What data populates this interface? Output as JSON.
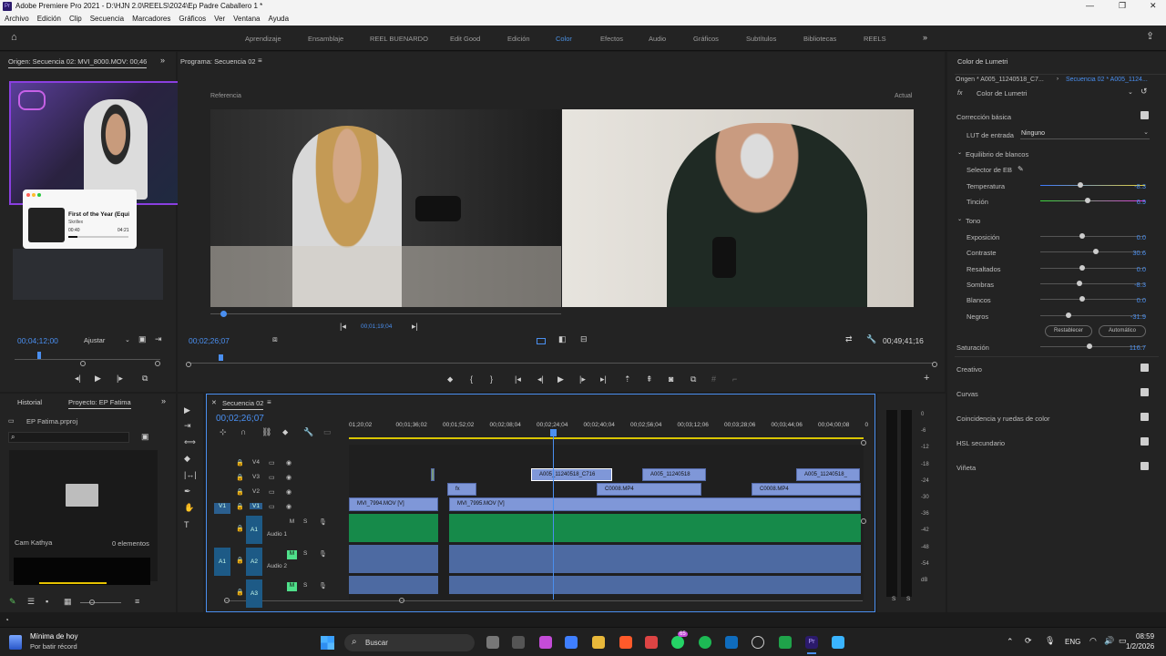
{
  "titlebar": {
    "title": "Adobe Premiere Pro 2021 - D:\\HJN 2.0\\REELS\\2024\\Ep Padre Caballero 1 *",
    "logo": "Pr"
  },
  "menu": [
    "Archivo",
    "Edición",
    "Clip",
    "Secuencia",
    "Marcadores",
    "Gráficos",
    "Ver",
    "Ventana",
    "Ayuda"
  ],
  "workspaces": [
    "Aprendizaje",
    "Ensamblaje",
    "REEL BUENARDO",
    "Edit Good",
    "Edición",
    "Color",
    "Efectos",
    "Audio",
    "Gráficos",
    "Subtítulos",
    "Bibliotecas",
    "REELS"
  ],
  "active_workspace": "Color",
  "source": {
    "tab": "Origen: Secuencia 02: MVI_8000.MOV: 00;46;0",
    "timecode": "00;04;12;00",
    "fit": "Ajustar"
  },
  "music_widget": {
    "title": "First of the Year (Equi",
    "artist": "Skrillex",
    "time_start": "00:40",
    "time_end": "04:21"
  },
  "program": {
    "tab": "Programa: Secuencia 02",
    "ref_label": "Referencia",
    "current_label": "Actual",
    "ref_timecode": "00;01;19;04",
    "timecode": "00;02;26;07",
    "duration": "00;49;41;16"
  },
  "project": {
    "tab_history": "Historial",
    "tab_project": "Proyecto: EP Fatima",
    "file": "EP Fatima.prproj",
    "bin_name": "Cam Kathya",
    "count": "0 elementos"
  },
  "timeline": {
    "tab": "Secuencia 02",
    "timecode": "00;02;26;07",
    "ruler": [
      "01;20;02",
      "00;01;36;02",
      "00;01;52;02",
      "00;02;08;04",
      "00;02;24;04",
      "00;02;40;04",
      "00;02;56;04",
      "00;03;12;06",
      "00;03;28;06",
      "00;03;44;06",
      "00;04;00;08",
      "0"
    ],
    "tracks_video": [
      "V4",
      "V3",
      "V2",
      "V1"
    ],
    "tracks_audio": [
      "A1",
      "A2",
      "A3"
    ],
    "audio_names": [
      "Audio 1",
      "Audio 2"
    ],
    "src_v": "V1",
    "src_a": "A1",
    "mute": "M",
    "solo": "S",
    "clips": {
      "v3a": "A005_11240518_C716",
      "v3b": "A005_11240518",
      "v3c": "A005_11240518_",
      "v2a": "fx",
      "v2b": "C0008.MP4",
      "v2c": "C0008.MP4",
      "v1a": "MVI_7994.MOV [V]",
      "v1b": "MVI_7995.MOV [V]"
    }
  },
  "meter": {
    "scale": [
      "0",
      "-6",
      "-12",
      "-18",
      "-24",
      "-30",
      "-36",
      "-42",
      "-48",
      "-54",
      "dB"
    ],
    "solo": [
      "S",
      "S"
    ]
  },
  "lumetri": {
    "panel_title": "Color de Lumetri",
    "origin": "Origen * A005_11240518_C7...",
    "sequence": "Secuencia 02 * A005_1124...",
    "effect": "Color de Lumetri",
    "basic": "Corrección básica",
    "lut_label": "LUT de entrada",
    "lut_value": "Ninguno",
    "wb_section": "Equilibrio de blancos",
    "wb_selector": "Selector de EB",
    "tone_section": "Tono",
    "sliders_wb": [
      {
        "label": "Temperatura",
        "value": "-8.3",
        "pos": 0.38
      },
      {
        "label": "Tinción",
        "value": "6.9",
        "pos": 0.45
      }
    ],
    "sliders_tone": [
      {
        "label": "Exposición",
        "value": "0.0",
        "pos": 0.4
      },
      {
        "label": "Contraste",
        "value": "30.6",
        "pos": 0.53
      },
      {
        "label": "Resaltados",
        "value": "0.0",
        "pos": 0.4
      },
      {
        "label": "Sombras",
        "value": "-8.3",
        "pos": 0.37
      },
      {
        "label": "Blancos",
        "value": "0.0",
        "pos": 0.4
      },
      {
        "label": "Negros",
        "value": "-31.9",
        "pos": 0.27
      }
    ],
    "btn_reset": "Restablecer",
    "btn_auto": "Automático",
    "saturation": {
      "label": "Saturación",
      "value": "116.7",
      "pos": 0.47
    },
    "sections": [
      "Creativo",
      "Curvas",
      "Coincidencia y ruedas de color",
      "HSL secundario",
      "Viñeta"
    ]
  },
  "taskbar": {
    "notif_title": "Mínima de hoy",
    "notif_sub": "Por batir récord",
    "search": "Buscar",
    "lang": "ENG",
    "time": "08:59",
    "date": "1/2/2026",
    "badge": "65"
  },
  "colors": {
    "accent": "#4a8ff0",
    "clip_video": "#7f97d8",
    "clip_audio": "#168a4a",
    "playhead": "#4a8ff0"
  }
}
